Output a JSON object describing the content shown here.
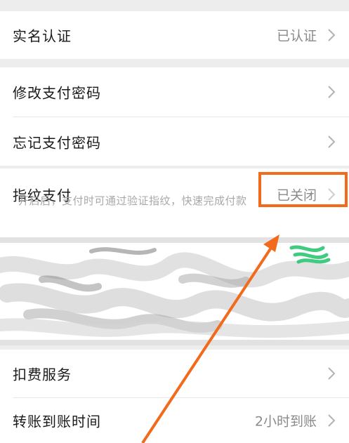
{
  "rows": {
    "realname": {
      "label": "实名认证",
      "value": "已认证"
    },
    "modify_pwd": {
      "label": "修改支付密码"
    },
    "forget_pwd": {
      "label": "忘记支付密码"
    },
    "fingerprint": {
      "label": "指纹支付",
      "value": "已关闭",
      "hint": "开启后，支付时可通过验证指纹，快速完成付款"
    },
    "deduction": {
      "label": "扣费服务"
    },
    "transfer_time": {
      "label": "转账到账时间",
      "value": "2小时到账"
    }
  },
  "colors": {
    "accent": "#f26a1b",
    "background": "#ededed",
    "card": "#ffffff",
    "label": "#1a1a1a",
    "value": "#8a8a8a"
  },
  "icons": {
    "chevron": "chevron-right-icon"
  }
}
